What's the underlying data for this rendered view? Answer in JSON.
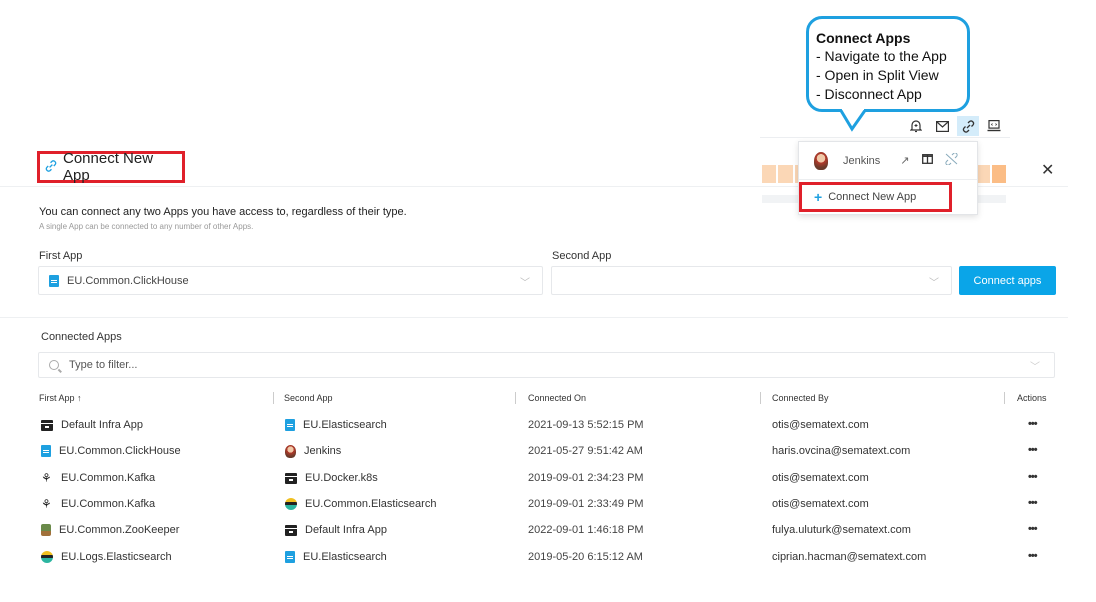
{
  "callout": {
    "title": "Connect Apps",
    "lines": [
      "- Navigate to the App",
      "- Open in Split View",
      "- Disconnect App"
    ]
  },
  "top_icons": [
    {
      "name": "bell-icon",
      "glyph": "🔔"
    },
    {
      "name": "mail-icon",
      "glyph": "✉"
    },
    {
      "name": "link-icon",
      "glyph": "🔗"
    },
    {
      "name": "laptop-icon",
      "glyph": "💻"
    }
  ],
  "modal": {
    "title": "Connect New App",
    "close": "✕",
    "intro": "You can connect any two Apps you have access to, regardless of their type.",
    "intro_sub": "A single App can be connected to any number of other Apps.",
    "first_app_label": "First App",
    "first_app_value": "EU.Common.ClickHouse",
    "second_app_label": "Second App",
    "second_app_value": "",
    "connect_button": "Connect apps",
    "accent_color": "#0aa5e8"
  },
  "dropdown": {
    "connected_app": "Jenkins",
    "actions": [
      "navigate-icon",
      "split-view-icon",
      "disconnect-icon"
    ],
    "connect_new": "Connect New App"
  },
  "connected_apps": {
    "title": "Connected Apps",
    "filter_placeholder": "Type to filter...",
    "columns": [
      "First App ↑",
      "Second App",
      "Connected On",
      "Connected By",
      "Actions"
    ],
    "rows": [
      {
        "first": "Default Infra App",
        "first_icon": "box",
        "second": "EU.Elasticsearch",
        "second_icon": "doc",
        "on": "2021-09-13 5:52:15 PM",
        "by": "otis@sematext.com",
        "actions": "•••"
      },
      {
        "first": "EU.Common.ClickHouse",
        "first_icon": "doc",
        "second": "Jenkins",
        "second_icon": "jenkins",
        "on": "2021-05-27 9:51:42 AM",
        "by": "haris.ovcina@sematext.com",
        "actions": "•••"
      },
      {
        "first": "EU.Common.Kafka",
        "first_icon": "kafka",
        "second": "EU.Docker.k8s",
        "second_icon": "box",
        "on": "2019-09-01 2:34:23 PM",
        "by": "otis@sematext.com",
        "actions": "•••"
      },
      {
        "first": "EU.Common.Kafka",
        "first_icon": "kafka",
        "second": "EU.Common.Elasticsearch",
        "second_icon": "elastic",
        "on": "2019-09-01 2:33:49 PM",
        "by": "otis@sematext.com",
        "actions": "•••"
      },
      {
        "first": "EU.Common.ZooKeeper",
        "first_icon": "zoo",
        "second": "Default Infra App",
        "second_icon": "box",
        "on": "2022-09-01 1:46:18 PM",
        "by": "fulya.uluturk@sematext.com",
        "actions": "•••"
      },
      {
        "first": "EU.Logs.Elasticsearch",
        "first_icon": "elastic",
        "second": "EU.Elasticsearch",
        "second_icon": "doc",
        "on": "2019-05-20 6:15:12 AM",
        "by": "ciprian.hacman@sematext.com",
        "actions": "•••"
      }
    ]
  }
}
